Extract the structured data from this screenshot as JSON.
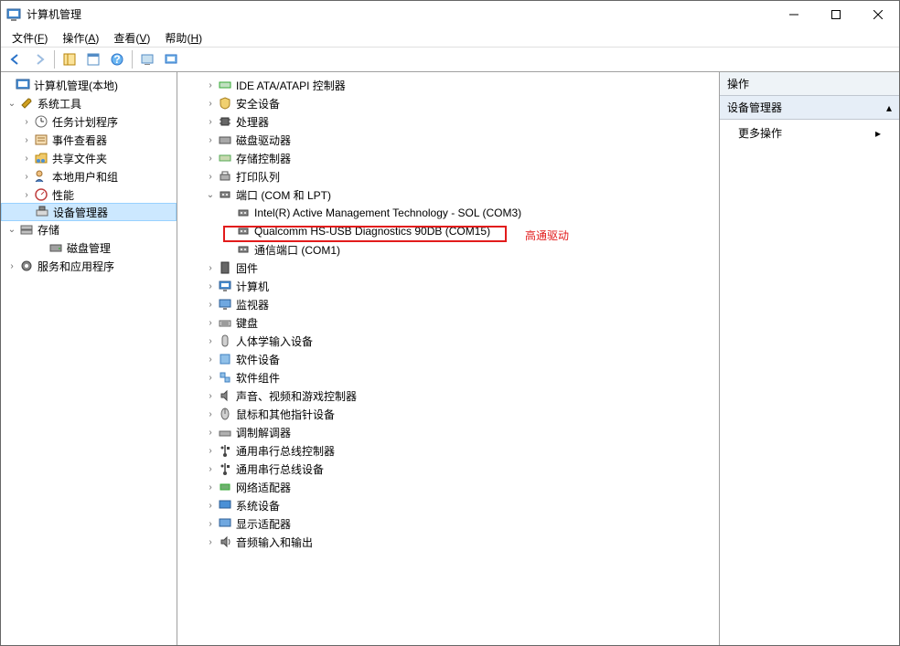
{
  "window": {
    "title": "计算机管理"
  },
  "menu": {
    "file": {
      "label": "文件",
      "accel": "F"
    },
    "action": {
      "label": "操作",
      "accel": "A"
    },
    "view": {
      "label": "查看",
      "accel": "V"
    },
    "help": {
      "label": "帮助",
      "accel": "H"
    }
  },
  "leftTree": {
    "root": "计算机管理(本地)",
    "sysTools": "系统工具",
    "taskScheduler": "任务计划程序",
    "eventViewer": "事件查看器",
    "sharedFolders": "共享文件夹",
    "localUsers": "本地用户和组",
    "performance": "性能",
    "deviceManager": "设备管理器",
    "storage": "存储",
    "diskMgmt": "磁盘管理",
    "servicesApps": "服务和应用程序"
  },
  "devices": {
    "ide": "IDE ATA/ATAPI 控制器",
    "security": "安全设备",
    "cpu": "处理器",
    "disk": "磁盘驱动器",
    "storage": "存储控制器",
    "printq": "打印队列",
    "ports": "端口 (COM 和 LPT)",
    "port1": "Intel(R) Active Management Technology - SOL (COM3)",
    "port2": "Qualcomm HS-USB Diagnostics 90DB (COM15)",
    "port3": "通信端口 (COM1)",
    "firmware": "固件",
    "computer": "计算机",
    "monitor": "监视器",
    "keyboard": "键盘",
    "hid": "人体学输入设备",
    "software": "软件设备",
    "swcomp": "软件组件",
    "audio": "声音、视频和游戏控制器",
    "mouse": "鼠标和其他指针设备",
    "modem": "调制解调器",
    "usbctrl": "通用串行总线控制器",
    "usbdev": "通用串行总线设备",
    "network": "网络适配器",
    "system": "系统设备",
    "display": "显示适配器",
    "audioio": "音频输入和输出"
  },
  "annotation": {
    "label": "高通驱动"
  },
  "actions": {
    "header": "操作",
    "section": "设备管理器",
    "moreActions": "更多操作"
  }
}
